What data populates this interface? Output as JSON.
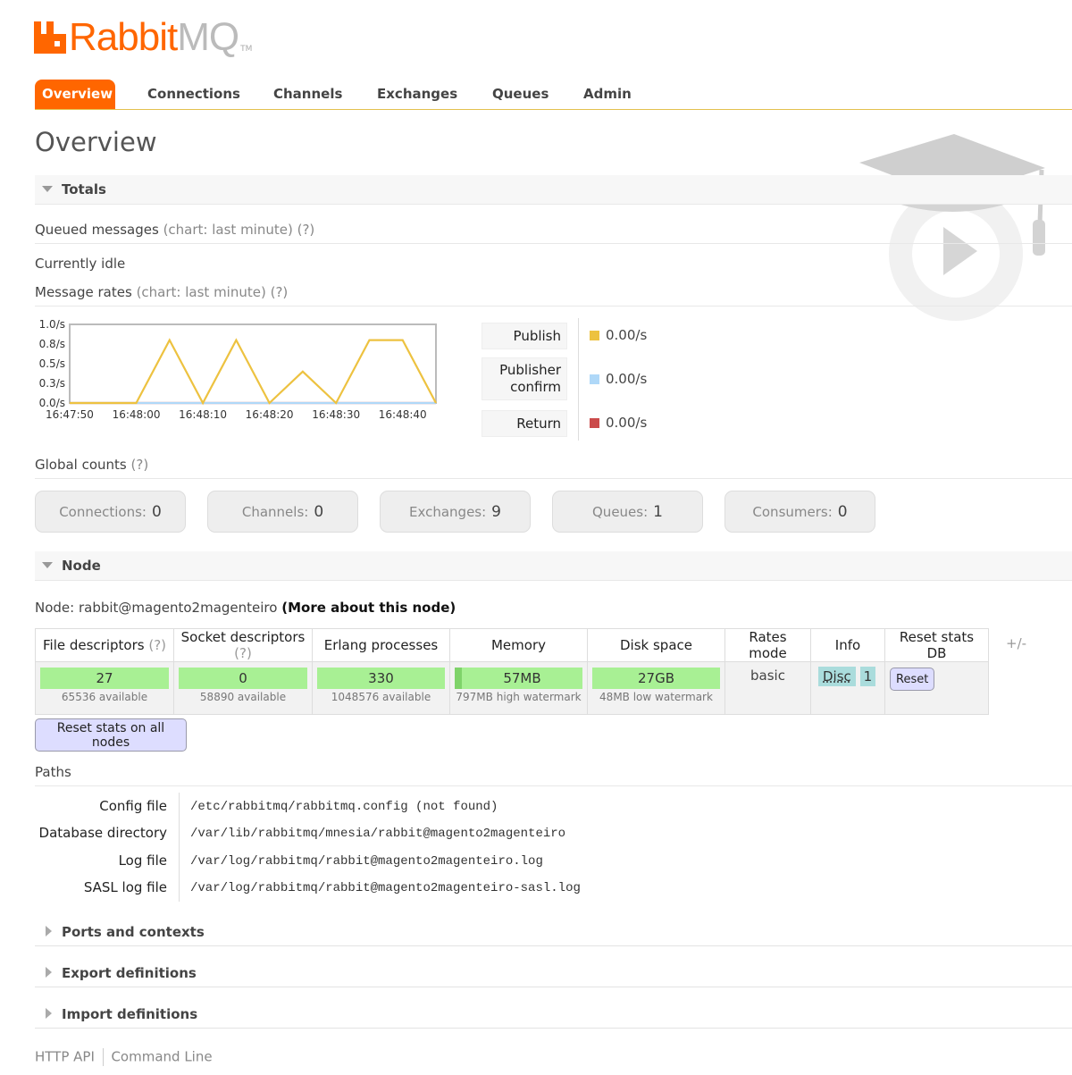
{
  "brand": {
    "name_main": "Rabbit",
    "name_sub": "MQ",
    "tm": "TM"
  },
  "nav": {
    "tabs": [
      "Overview",
      "Connections",
      "Channels",
      "Exchanges",
      "Queues",
      "Admin"
    ],
    "active": "Overview"
  },
  "page": {
    "title": "Overview"
  },
  "totals": {
    "header": "Totals",
    "queued_label": "Queued messages",
    "queued_hint": "(chart: last minute) (?)",
    "idle_text": "Currently idle",
    "rates_label": "Message rates",
    "rates_hint": "(chart: last minute) (?)",
    "legend": [
      {
        "label": "Publish",
        "value": "0.00/s",
        "color": "#edc240"
      },
      {
        "label": "Publisher confirm",
        "value": "0.00/s",
        "color": "#afd8f8"
      },
      {
        "label": "Return",
        "value": "0.00/s",
        "color": "#cb4b4b"
      }
    ]
  },
  "chart_data": {
    "type": "line",
    "x": [
      "16:47:50",
      "16:47:55",
      "16:48:00",
      "16:48:05",
      "16:48:10",
      "16:48:15",
      "16:48:20",
      "16:48:25",
      "16:48:30",
      "16:48:35",
      "16:48:40",
      "16:48:45"
    ],
    "xticks": [
      "16:47:50",
      "16:48:00",
      "16:48:10",
      "16:48:20",
      "16:48:30",
      "16:48:40"
    ],
    "yticks": [
      "1.0/s",
      "0.8/s",
      "0.5/s",
      "0.3/s",
      "0.0/s"
    ],
    "ylim": [
      0,
      1.0
    ],
    "series": [
      {
        "name": "Publish",
        "color": "#edc240",
        "values": [
          0,
          0,
          0,
          0.8,
          0,
          0.8,
          0,
          0.4,
          0,
          0.8,
          0.8,
          0
        ]
      },
      {
        "name": "Publisher confirm",
        "color": "#afd8f8",
        "values": [
          0,
          0,
          0,
          0,
          0,
          0,
          0,
          0,
          0,
          0,
          0,
          0
        ]
      },
      {
        "name": "Return",
        "color": "#cb4b4b",
        "values": [
          0,
          0,
          0,
          0,
          0,
          0,
          0,
          0,
          0,
          0,
          0,
          0
        ]
      }
    ]
  },
  "global_counts": {
    "label": "Global counts",
    "hint": "(?)",
    "items": [
      {
        "label": "Connections:",
        "value": "0"
      },
      {
        "label": "Channels:",
        "value": "0"
      },
      {
        "label": "Exchanges:",
        "value": "9"
      },
      {
        "label": "Queues:",
        "value": "1"
      },
      {
        "label": "Consumers:",
        "value": "0"
      }
    ]
  },
  "node": {
    "header": "Node",
    "prefix": "Node:",
    "name": "rabbit@magento2magenteiro",
    "more_link": "(More about this node)",
    "table": {
      "headers": [
        "File descriptors",
        "Socket descriptors",
        "Erlang processes",
        "Memory",
        "Disk space",
        "Rates mode",
        "Info",
        "Reset stats DB"
      ],
      "hint": "(?)",
      "plus_minus": "+/-",
      "file_descriptors": {
        "value": "27",
        "sub": "65536 available"
      },
      "socket_descriptors": {
        "value": "0",
        "sub": "58890 available"
      },
      "erlang_processes": {
        "value": "330",
        "sub": "1048576 available"
      },
      "memory": {
        "value": "57MB",
        "sub": "797MB high watermark"
      },
      "disk_space": {
        "value": "27GB",
        "sub": "48MB low watermark"
      },
      "rates_mode": "basic",
      "info_disc": "Disc",
      "info_count": "1",
      "reset_button": "Reset"
    },
    "reset_all_button": "Reset stats on all nodes"
  },
  "paths": {
    "label": "Paths",
    "rows": [
      {
        "label": "Config file",
        "value": "/etc/rabbitmq/rabbitmq.config (not found)"
      },
      {
        "label": "Database directory",
        "value": "/var/lib/rabbitmq/mnesia/rabbit@magento2magenteiro"
      },
      {
        "label": "Log file",
        "value": "/var/log/rabbitmq/rabbit@magento2magenteiro.log"
      },
      {
        "label": "SASL log file",
        "value": "/var/log/rabbitmq/rabbit@magento2magenteiro-sasl.log"
      }
    ]
  },
  "collapsed_sections": [
    "Ports and contexts",
    "Export definitions",
    "Import definitions"
  ],
  "footer": {
    "links": [
      "HTTP API",
      "Command Line"
    ]
  }
}
